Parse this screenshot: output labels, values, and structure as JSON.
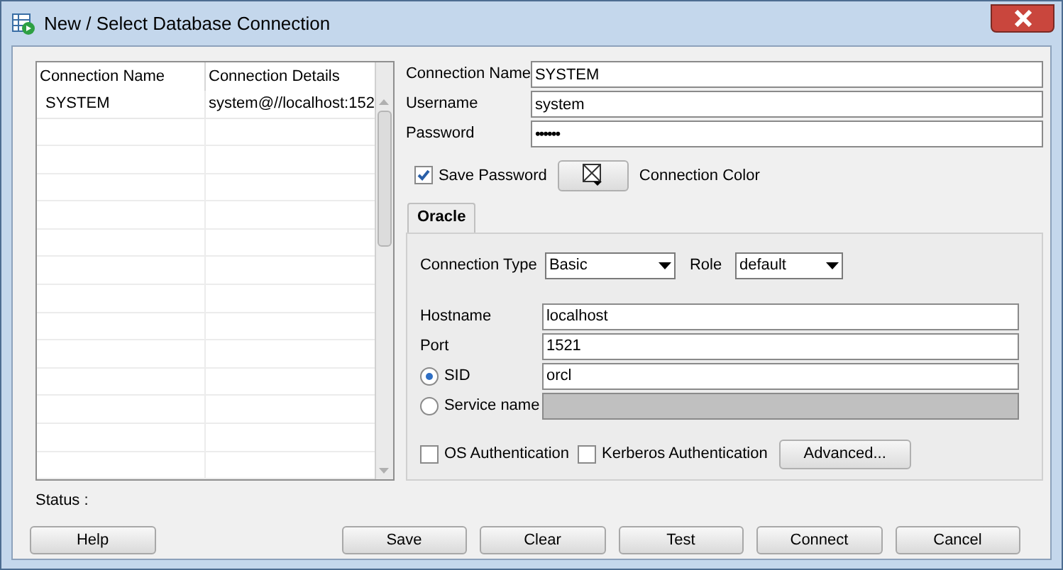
{
  "window": {
    "title": "New / Select Database Connection"
  },
  "connections_table": {
    "columns": [
      "Connection Name",
      "Connection Details"
    ],
    "rows": [
      {
        "cells": [
          "SYSTEM",
          "system@//localhost:152"
        ],
        "selected": false
      }
    ]
  },
  "form": {
    "fields": [
      {
        "label": "Connection Name",
        "value": "SYSTEM",
        "kind": "text"
      },
      {
        "label": "Username",
        "value": "system",
        "kind": "text"
      },
      {
        "label": "Password",
        "value": "••••••",
        "kind": "password"
      }
    ],
    "save_password": {
      "label": "Save Password",
      "checked": true
    },
    "connection_color_label": "Connection Color"
  },
  "tabs": [
    {
      "label": "Oracle",
      "selected": true
    }
  ],
  "oracle": {
    "connection_type": {
      "label": "Connection Type",
      "value": "Basic"
    },
    "role": {
      "label": "Role",
      "value": "default"
    },
    "fields": [
      {
        "kind": "text",
        "label": "Hostname",
        "value": "localhost",
        "disabled": false
      },
      {
        "kind": "text",
        "label": "Port",
        "value": "1521",
        "disabled": false
      },
      {
        "kind": "radio",
        "label": "SID",
        "value": "orcl",
        "selected": true,
        "disabled": false
      },
      {
        "kind": "radio",
        "label": "Service name",
        "selected": false,
        "disabled": true
      }
    ],
    "checkboxes": [
      {
        "label": "OS Authentication",
        "checked": false
      },
      {
        "label": "Kerberos Authentication",
        "checked": false
      }
    ],
    "advanced_button": "Advanced..."
  },
  "status_label": "Status :",
  "buttons": [
    {
      "label": "Help",
      "kind": "left"
    },
    {
      "label": "Save",
      "kind": "right"
    },
    {
      "label": "Clear",
      "kind": "right"
    },
    {
      "label": "Test",
      "kind": "right"
    },
    {
      "label": "Connect",
      "kind": "right"
    },
    {
      "label": "Cancel",
      "kind": "right"
    }
  ]
}
